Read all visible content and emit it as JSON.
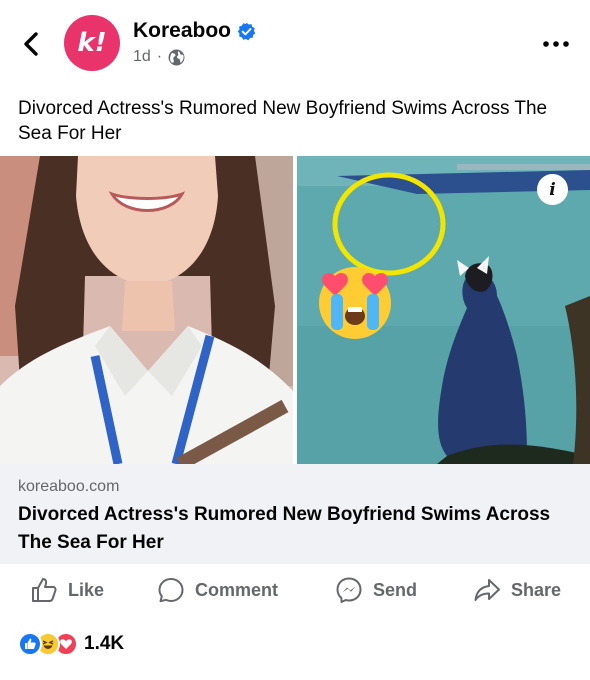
{
  "header": {
    "page_name": "Koreaboo",
    "avatar_letter": "k!",
    "timestamp": "1d",
    "separator": "·",
    "brand_color": "#e8336b",
    "verified_color": "#1877f2"
  },
  "post": {
    "text": "Divorced Actress's Rumored New Boyfriend Swims Across The Sea For Her"
  },
  "media": {
    "left_image": "portrait of smiling woman with lanyard",
    "right_image": "woman sitting by sea with emoji and circle highlight",
    "emoji": "heart-eyes-crying-emoji",
    "highlight_color": "#f2e600",
    "info_label": "i"
  },
  "link_preview": {
    "domain": "koreaboo.com",
    "title": "Divorced Actress's Rumored New Boyfriend Swims Across The Sea For Her"
  },
  "actions": [
    {
      "label": "Like",
      "icon": "thumbs-up-icon"
    },
    {
      "label": "Comment",
      "icon": "comment-icon"
    },
    {
      "label": "Send",
      "icon": "messenger-icon"
    },
    {
      "label": "Share",
      "icon": "share-icon"
    }
  ],
  "reactions": {
    "types": [
      "like",
      "haha",
      "love"
    ],
    "count": "1.4K"
  }
}
